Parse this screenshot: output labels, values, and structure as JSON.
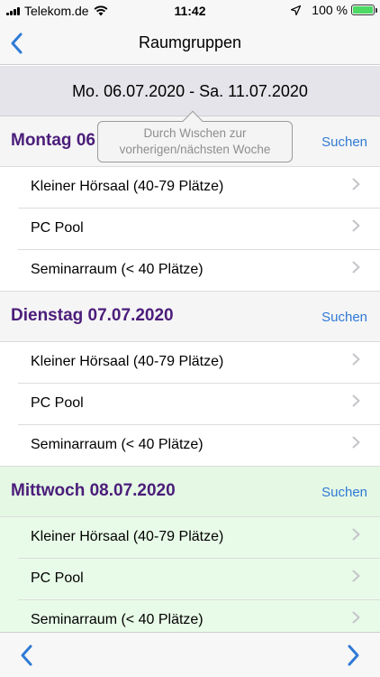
{
  "status_bar": {
    "carrier": "Telekom.de",
    "time": "11:42",
    "battery": "100 %",
    "battery_level": 1.0
  },
  "nav": {
    "title": "Raumgruppen"
  },
  "week": {
    "range": "Mo. 06.07.2020 - Sa. 11.07.2020"
  },
  "tooltip": {
    "line1": "Durch Wischen zur",
    "line2": "vorherigen/nächsten Woche"
  },
  "days": [
    {
      "title": "Montag 06",
      "search": "Suchen",
      "rooms": [
        "Kleiner Hörsaal  (40-79 Plätze)",
        "PC Pool",
        "Seminarraum (< 40 Plätze)"
      ]
    },
    {
      "title": "Dienstag 07.07.2020",
      "search": "Suchen",
      "rooms": [
        "Kleiner Hörsaal  (40-79 Plätze)",
        "PC Pool",
        "Seminarraum (< 40 Plätze)"
      ]
    },
    {
      "title": "Mittwoch 08.07.2020",
      "search": "Suchen",
      "rooms": [
        "Kleiner Hörsaal  (40-79 Plätze)",
        "PC Pool",
        "Seminarraum (< 40 Plätze)"
      ]
    }
  ],
  "colors": {
    "accent": "#2f7ad6",
    "day_title": "#4b1d7a",
    "today_bg": "#e8fbe8"
  },
  "icons": {
    "back": "chevron-left-icon",
    "row": "chevron-right-icon",
    "toolbar_prev": "chevron-left-icon",
    "toolbar_next": "chevron-right-icon"
  }
}
